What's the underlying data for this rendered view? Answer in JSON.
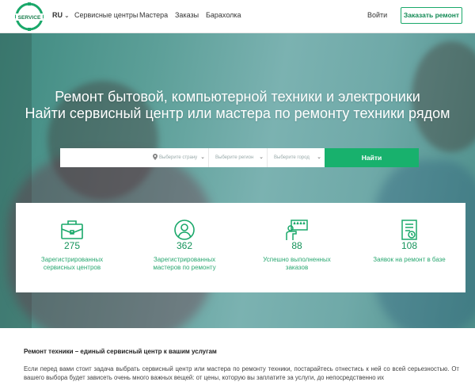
{
  "header": {
    "logo_text": "SERVICE",
    "lang": "RU",
    "nav": [
      {
        "label": "Сервисные центры"
      },
      {
        "label": "Мастера"
      },
      {
        "label": "Заказы"
      },
      {
        "label": "Барахолка"
      }
    ],
    "login": "Войти",
    "order_button": "Заказать ремонт"
  },
  "hero": {
    "title_line1": "Ремонт бытовой, компьютерной техники и электроники",
    "title_line2": "Найти сервисный центр или мастера по ремонту техники рядом"
  },
  "search": {
    "input_value": "",
    "country_placeholder": "Выберите страну",
    "region_placeholder": "Выберите регион",
    "city_placeholder": "Выберите город",
    "button": "Найти"
  },
  "stats": {
    "items": [
      {
        "icon": "briefcase-icon",
        "value": "275",
        "label_line1": "Зарегистрированных",
        "label_line2": "сервисных центров"
      },
      {
        "icon": "user-icon",
        "value": "362",
        "label_line1": "Зарегистрированных",
        "label_line2": "мастеров по ремонту"
      },
      {
        "icon": "rating-board-icon",
        "value": "88",
        "label_line1": "Успешно выполненных",
        "label_line2": "заказов"
      },
      {
        "icon": "order-list-icon",
        "value": "108",
        "label_line1": "Заявок на ремонт в базе",
        "label_line2": ""
      }
    ]
  },
  "content": {
    "title": "Ремонт техники – единый сервисный центр к вашим услугам",
    "paragraph": "Если перед вами стоит задача выбрать сервисный центр или мастера по ремонту техники, постарайтесь отнестись к ней со всей серьезностью. От вашего выбора будет зависеть очень много важных вещей: от цены, которую вы заплатите за услуги, до непосредственно их"
  },
  "colors": {
    "brand_green": "#18b16d",
    "stat_green": "#14935a"
  }
}
